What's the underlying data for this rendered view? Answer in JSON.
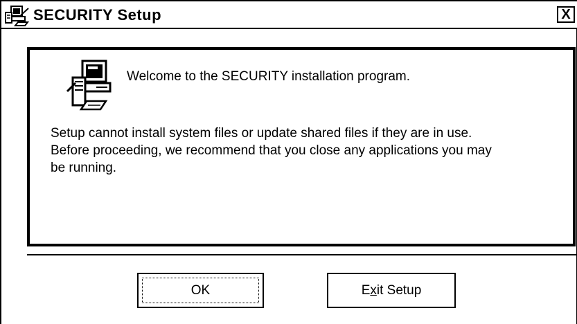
{
  "window": {
    "title": "SECURITY Setup",
    "close_label": "X",
    "icons": {
      "title": "setup-computer-icon",
      "close": "close-icon",
      "panel": "computer-setup-icon"
    }
  },
  "panel": {
    "welcome": "Welcome to the SECURITY installation program.",
    "message_lines": [
      "Setup cannot install system files or update shared files if they are in use.",
      "Before proceeding, we recommend that you close any applications you may",
      "be running."
    ]
  },
  "buttons": {
    "ok": "OK",
    "exit_prefix": "E",
    "exit_mnemonic": "x",
    "exit_suffix": "it Setup"
  }
}
